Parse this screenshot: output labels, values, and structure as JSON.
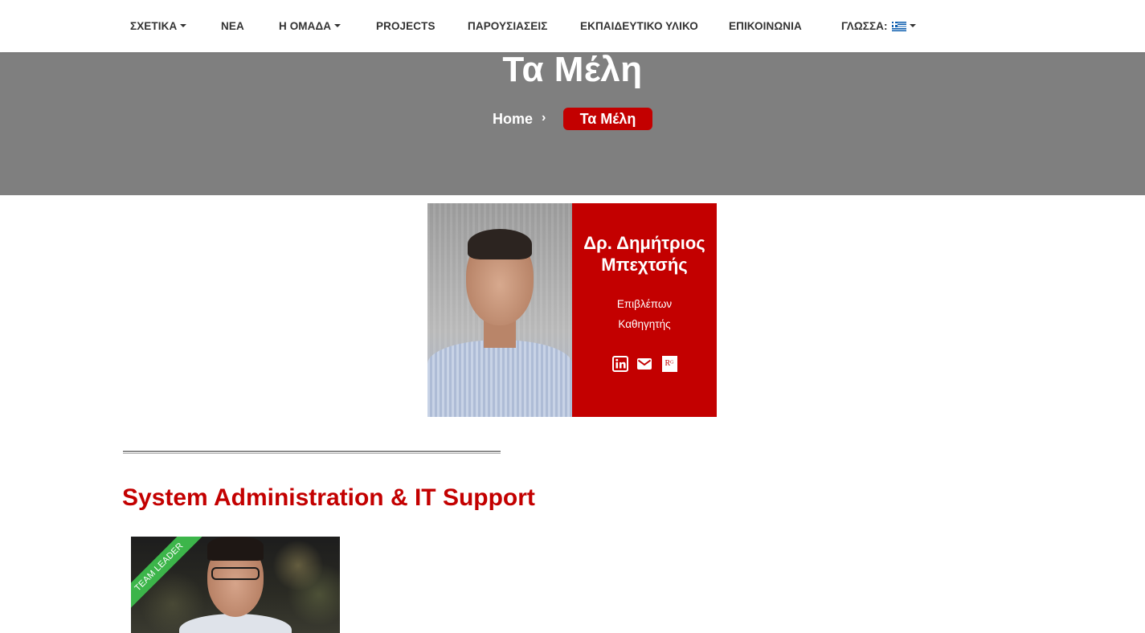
{
  "nav": {
    "items": [
      {
        "label": "ΣΧΕΤΙΚΑ",
        "dropdown": true
      },
      {
        "label": "ΝΕΑ",
        "dropdown": false
      },
      {
        "label": "Η ΟΜΑΔΑ",
        "dropdown": true
      },
      {
        "label": "PROJECTS",
        "dropdown": false
      },
      {
        "label": "ΠΑΡΟΥΣΙΑΣΕΙΣ",
        "dropdown": false
      },
      {
        "label": "ΕΚΠΑΙΔΕΥΤΙΚΟ ΥΛΙΚΟ",
        "dropdown": false
      },
      {
        "label": "ΕΠΙΚΟΙΝΩΝΙΑ",
        "dropdown": false
      }
    ],
    "language": {
      "label": "ΓΛΩΣΣΑ:",
      "icon": "greek-flag-icon"
    }
  },
  "hero": {
    "title": "Τα Μέλη",
    "breadcrumb": {
      "home": "Home",
      "separator": "›",
      "current": "Τα Μέλη"
    }
  },
  "supervisor": {
    "name": "Δρ. Δημήτριος Μπεχτσής",
    "role": "Επιβλέπων Καθηγητής",
    "social": [
      "linkedin-icon",
      "email-icon",
      "researchgate-icon"
    ],
    "researchgate_glyph": "Rᴳ"
  },
  "section": {
    "heading": "System Administration & IT Support",
    "badge": "TEAM LEADER"
  },
  "colors": {
    "accent": "#c30000",
    "hero_bg": "#7f7f7f",
    "badge": "#3cb54a"
  }
}
